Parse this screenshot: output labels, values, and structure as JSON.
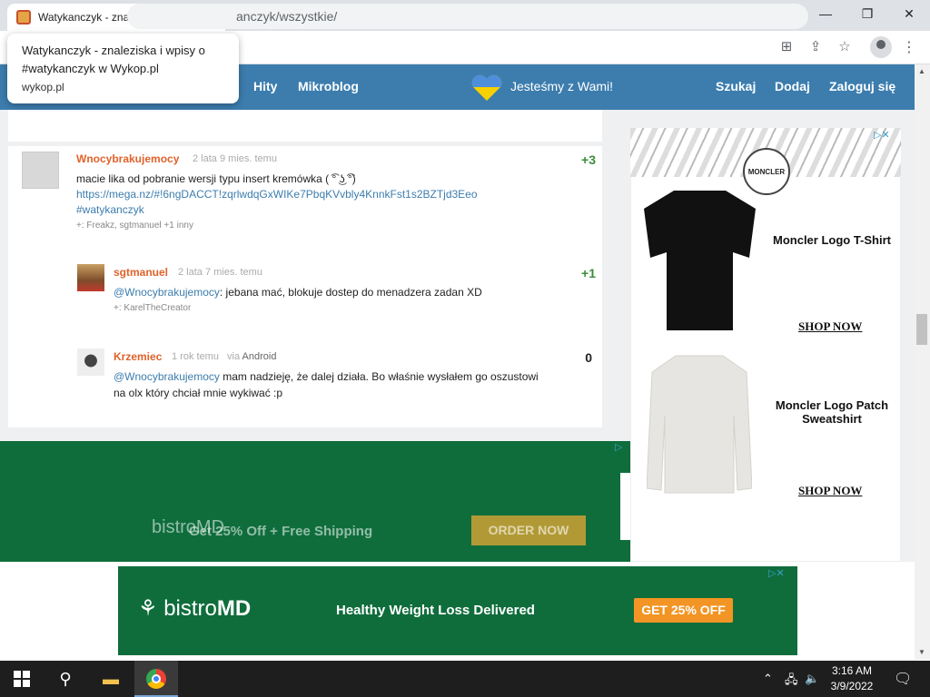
{
  "browser": {
    "tab_title": "Watykanczyk - znaleziska i wpisy",
    "tab_close": "✕",
    "new_tab": "+",
    "url_visible": "anczyk/wszystkie/",
    "tooltip": {
      "title": "Watykanczyk - znaleziska i wpisy o #watykanczyk w Wykop.pl",
      "domain": "wykop.pl"
    }
  },
  "nav": {
    "hits": "Hity",
    "microblog": "Mikroblog",
    "ukraine_text": "Jesteśmy z Wami!",
    "search": "Szukaj",
    "add": "Dodaj",
    "login": "Zaloguj się"
  },
  "posts": [
    {
      "author": "Wnocybrakujemocy",
      "time": "2 lata 9 mies. temu",
      "votes": "+3",
      "text": "macie lika od pobranie wersji typu insert kremówka ( ͡° ͜ʖ ͡°)",
      "link": "https://mega.nz/#!6ngDACCT!zqrlwdqGxWIKe7PbqKVvbly4KnnkFst1s2BZTjd3Eeo",
      "tag": "#watykanczyk",
      "plus": "+: Freakz, sgtmanuel +1 inny"
    },
    {
      "author": "sgtmanuel",
      "time": "2 lata 7 mies. temu",
      "votes": "+1",
      "mention": "@Wnocybrakujemocy",
      "text": ": jebana mać, blokuje dostep do menadzera zadan XD",
      "plus": "+: KarelTheCreator"
    },
    {
      "author": "Krzemiec",
      "time": "1 rok temu",
      "via_prefix": "via",
      "via": "Android",
      "votes": "0",
      "mention": "@Wnocybrakujemocy",
      "text_line1": " mam nadzieję, że dalej działa. Bo właśnie wysłałem go oszustowi",
      "text_line2": "na olx który chciał mnie wykiwać :p"
    }
  ],
  "ads": {
    "side": {
      "badge": "MONCLER",
      "product1": "Moncler Logo T-Shirt",
      "shop1": "SHOP NOW",
      "product2": "Moncler Logo Patch Sweatshirt",
      "shop2": "SHOP NOW",
      "adchoice": "▷✕"
    },
    "mid": {
      "logo": "bistroMD",
      "offer": "Get 25% Off + Free Shipping",
      "button": "ORDER NOW",
      "adchoice": "▷"
    },
    "bottom": {
      "logo_light": "bistro",
      "logo_bold": "MD",
      "headline": "Healthy Weight Loss Delivered",
      "button": "GET 25% OFF",
      "adchoice": "▷✕"
    }
  },
  "taskbar": {
    "time": "3:16 AM",
    "date": "3/9/2022"
  },
  "colors": {
    "nav_blue": "#3c7dae",
    "author_orange": "#e0622a",
    "vote_green": "#3a8c3a",
    "ad_green": "#0f6d3c",
    "ad_orange": "#f29524"
  }
}
